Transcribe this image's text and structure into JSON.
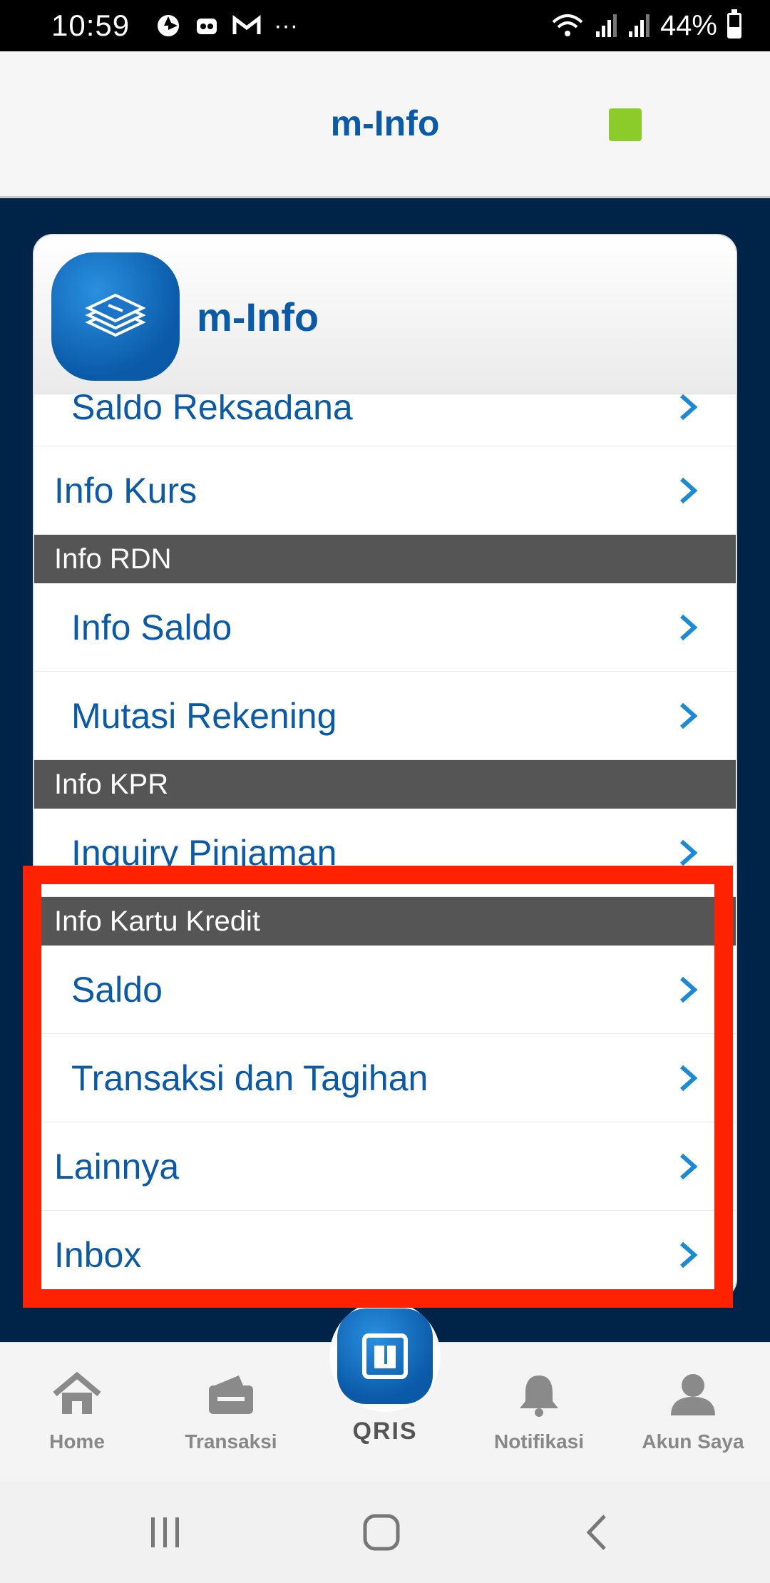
{
  "status_bar": {
    "time": "10:59",
    "left_icons": [
      "camera-shutter-icon",
      "notification-bot-icon",
      "gmail-icon",
      "more-dots-icon"
    ],
    "more_label": "···",
    "battery_level": "44%"
  },
  "header": {
    "title": "m-Info",
    "indicator_color": "#8ccc2a"
  },
  "card": {
    "title": "m-Info",
    "partial_row": "Saldo Reksadana",
    "rows_top": [
      {
        "label": "Info Kurs"
      }
    ],
    "sections": [
      {
        "title": "Info RDN",
        "items": [
          "Info Saldo",
          "Mutasi Rekening"
        ]
      },
      {
        "title": "Info KPR",
        "items": [
          "Inquiry Pinjaman"
        ]
      },
      {
        "title": "Info Kartu Kredit",
        "items": [
          "Saldo",
          "Transaksi dan Tagihan"
        ]
      }
    ],
    "rows_bottom": [
      {
        "label": "Lainnya"
      },
      {
        "label": "Inbox"
      }
    ]
  },
  "bottom_nav": {
    "items": [
      {
        "label": "Home",
        "icon": "home-icon"
      },
      {
        "label": "Transaksi",
        "icon": "wallet-icon"
      },
      {
        "label": "Notifikasi",
        "icon": "bell-icon"
      },
      {
        "label": "Akun Saya",
        "icon": "user-icon"
      }
    ],
    "qris_label": "QRIS"
  },
  "colors": {
    "primary": "#0a5aa8",
    "background": "#002447",
    "section_bg": "#555555",
    "highlight": "#ff2200"
  }
}
